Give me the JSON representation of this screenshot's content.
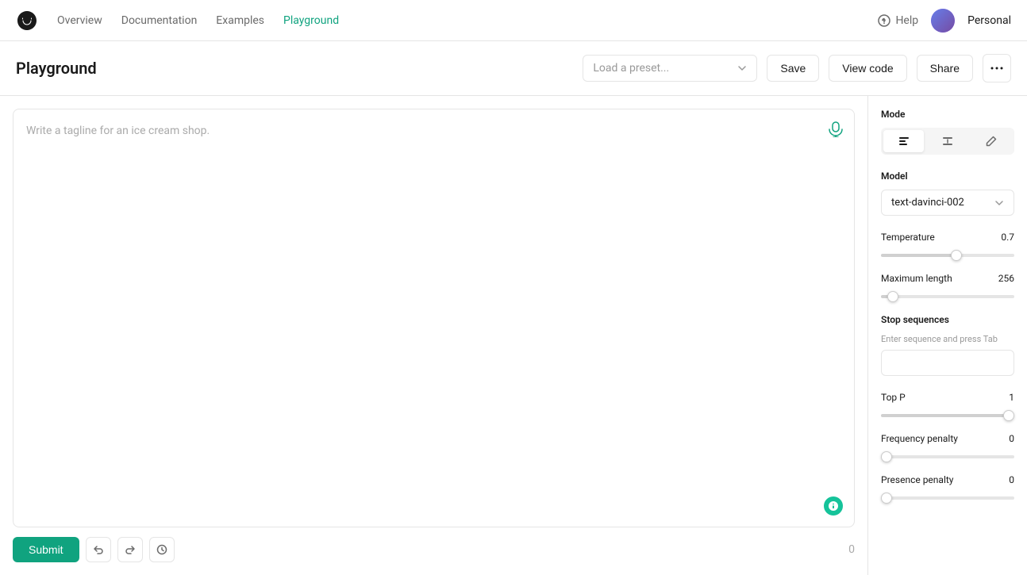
{
  "nav": {
    "links": [
      {
        "label": "Overview",
        "active": false
      },
      {
        "label": "Documentation",
        "active": false
      },
      {
        "label": "Examples",
        "active": false
      },
      {
        "label": "Playground",
        "active": true
      }
    ],
    "help_label": "Help",
    "account_label": "Personal"
  },
  "header": {
    "title": "Playground",
    "preset_placeholder": "Load a preset...",
    "save_label": "Save",
    "view_code_label": "View code",
    "share_label": "Share"
  },
  "editor": {
    "placeholder": "Write a tagline for an ice cream shop.",
    "char_count": "0",
    "submit_label": "Submit"
  },
  "sidebar": {
    "mode_label": "Mode",
    "model_label": "Model",
    "model_value": "text-davinci-002",
    "temperature_label": "Temperature",
    "temperature_value": "0.7",
    "temperature_slider": 57,
    "max_length_label": "Maximum length",
    "max_length_value": "256",
    "max_length_slider": 5,
    "stop_sequences_label": "Stop sequences",
    "stop_sequences_hint": "Enter sequence and press Tab",
    "top_p_label": "Top P",
    "top_p_value": "1",
    "top_p_slider": 100,
    "freq_penalty_label": "Frequency penalty",
    "freq_penalty_value": "0",
    "freq_penalty_slider": 0,
    "presence_penalty_label": "Presence penalty",
    "presence_penalty_value": "0",
    "presence_penalty_slider": 0
  }
}
